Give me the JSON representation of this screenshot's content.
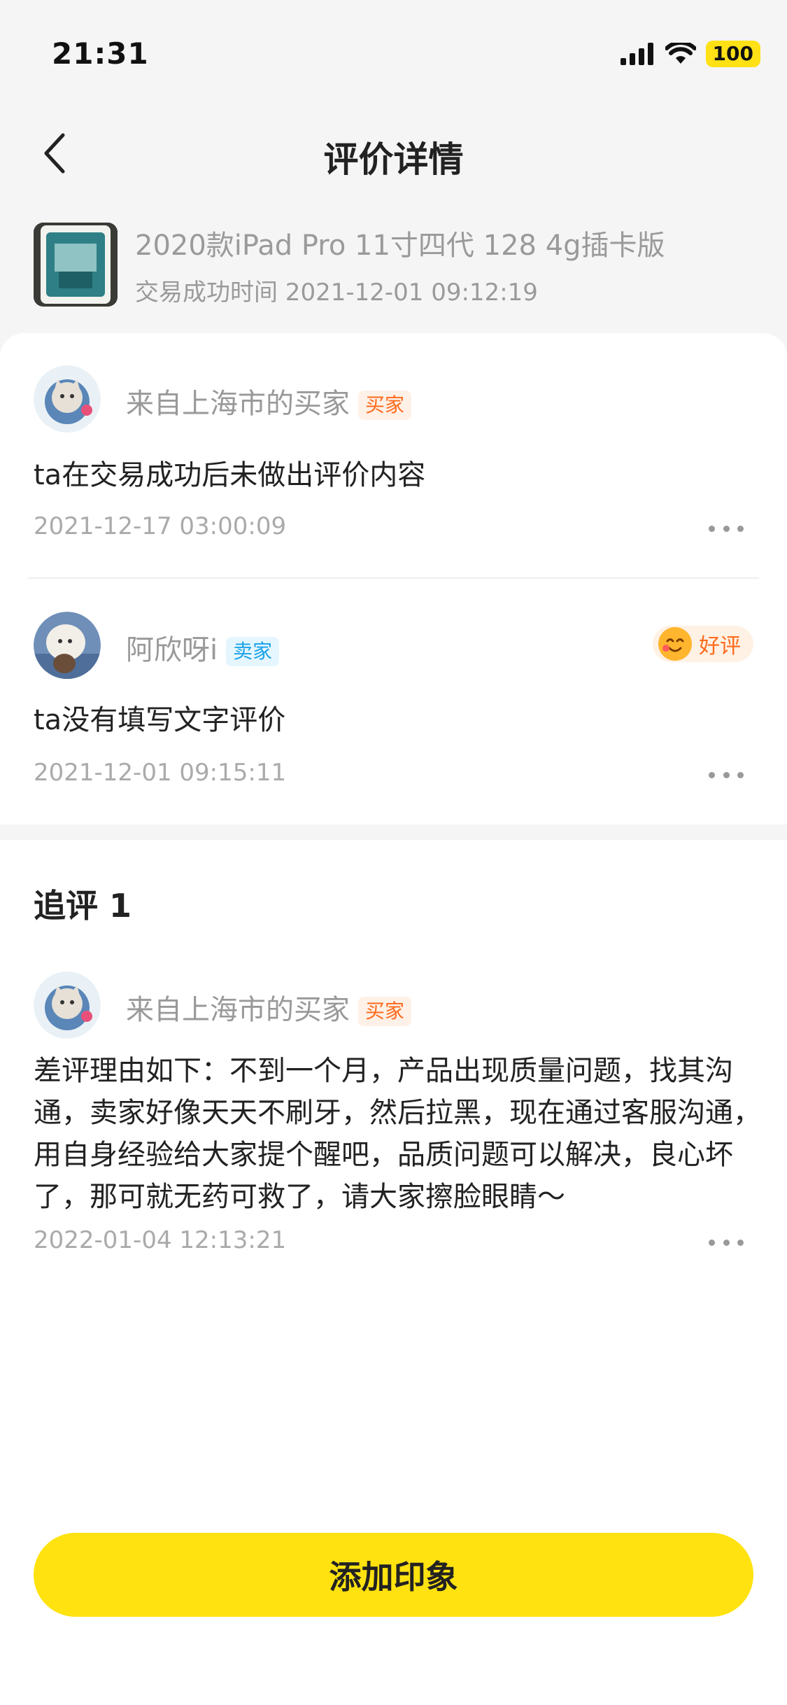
{
  "status_bar": {
    "time": "21:31",
    "battery": "100"
  },
  "nav": {
    "title": "评价详情"
  },
  "product": {
    "name": "2020款iPad Pro 11寸四代 128  4g插卡版",
    "trade_time": "交易成功时间 2021-12-01 09:12:19"
  },
  "reviews": [
    {
      "name": "来自上海市的买家",
      "tag": "买家",
      "text": "ta在交易成功后未做出评价内容",
      "date": "2021-12-17 03:00:09"
    },
    {
      "name": "阿欣呀i",
      "tag": "卖家",
      "badge": "好评",
      "text": "ta没有填写文字评价",
      "date": "2021-12-01 09:15:11"
    }
  ],
  "follow_up": {
    "title": "追评 1",
    "name": "来自上海市的买家",
    "tag": "买家",
    "text": "差评理由如下：不到一个月，产品出现质量问题，找其沟通，卖家好像天天不刷牙，然后拉黑，现在通过客服沟通，用自身经验给大家提个醒吧，品质问题可以解决，良心坏了，那可就无药可救了，请大家擦脸眼睛～",
    "date": "2022-01-04 12:13:21"
  },
  "actions": {
    "add_impression": "添加印象"
  },
  "colors": {
    "accent": "#ffe20f",
    "buyer_tag": "#ff6a1a",
    "seller_tag": "#1aa3e8"
  },
  "icons": [
    "back-arrow-icon",
    "signal-icon",
    "wifi-icon",
    "more-icon",
    "smile-emoji-icon"
  ]
}
